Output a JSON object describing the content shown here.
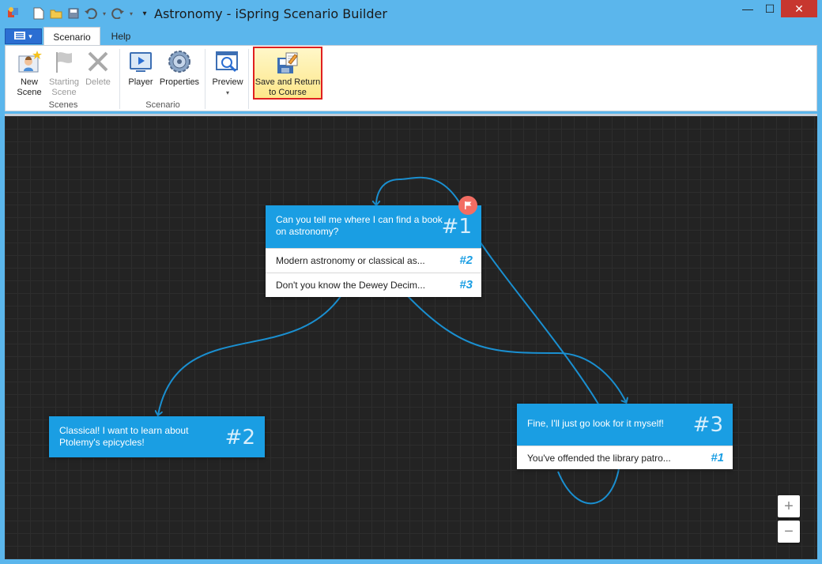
{
  "window": {
    "title": "Astronomy - iSpring Scenario Builder",
    "min_glyph": "—",
    "max_glyph": "☐",
    "close_glyph": "✕"
  },
  "quick_access": [
    "new-document-icon",
    "open-folder-icon",
    "save-icon",
    "undo-icon",
    "redo-icon",
    "customize-dropdown-icon"
  ],
  "tabs": {
    "file_icon": "menu-icon",
    "scenario": "Scenario",
    "help": "Help"
  },
  "ribbon": {
    "scenes_group": {
      "label": "Scenes",
      "new_scene": "New Scene",
      "starting_scene": "Starting Scene",
      "delete": "Delete"
    },
    "scenario_group": {
      "label": "Scenario",
      "player": "Player",
      "properties": "Properties"
    },
    "preview": "Preview",
    "save_return": "Save and Return to Course"
  },
  "scenes": [
    {
      "number": "#1",
      "text": "Can you tell me where I can find a book on astronomy?",
      "starting": true,
      "choices": [
        {
          "text": "Modern astronomy or classical as...",
          "target": "#2"
        },
        {
          "text": "Don't you know the Dewey Decim...",
          "target": "#3"
        }
      ]
    },
    {
      "number": "#2",
      "text": "Classical! I want to learn about Ptolemy's epicycles!",
      "starting": false,
      "choices": []
    },
    {
      "number": "#3",
      "text": "Fine, I'll just go look for it myself!",
      "starting": false,
      "choices": [
        {
          "text": "You've offended the library patro...",
          "target": "#1"
        }
      ]
    }
  ],
  "zoom": {
    "in": "+",
    "out": "−"
  },
  "colors": {
    "scene_header": "#1a9ee3",
    "canvas": "#232323",
    "link": "#1a8fd0",
    "flag": "#f26d63",
    "highlight_border": "#e02020"
  }
}
